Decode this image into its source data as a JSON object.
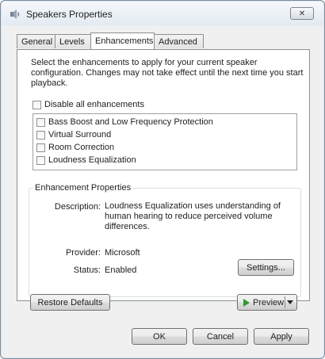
{
  "window": {
    "title": "Speakers Properties",
    "close_glyph": "✕"
  },
  "tabs": [
    {
      "label": "General"
    },
    {
      "label": "Levels"
    },
    {
      "label": "Enhancements",
      "active": true
    },
    {
      "label": "Advanced"
    }
  ],
  "enhancements": {
    "description": "Select the enhancements to apply for your current speaker configuration. Changes may not take effect until the next time you start playback.",
    "disable_all_label": "Disable all enhancements",
    "disable_all_checked": false,
    "items": [
      {
        "label": "Bass Boost and Low Frequency Protection",
        "checked": false
      },
      {
        "label": "Virtual Surround",
        "checked": false
      },
      {
        "label": "Room Correction",
        "checked": false
      },
      {
        "label": "Loudness Equalization",
        "checked": false
      }
    ]
  },
  "properties": {
    "group_label": "Enhancement Properties",
    "description_label": "Description:",
    "description_value": "Loudness Equalization uses understanding of human hearing to reduce perceived volume differences.",
    "provider_label": "Provider:",
    "provider_value": "Microsoft",
    "status_label": "Status:",
    "status_value": "Enabled",
    "settings_button": "Settings..."
  },
  "actions": {
    "restore_defaults": "Restore Defaults",
    "preview": "Preview"
  },
  "footer": {
    "ok": "OK",
    "cancel": "Cancel",
    "apply": "Apply"
  },
  "icons": {
    "window_icon": "speaker-icon",
    "preview_icon": "play-icon",
    "dropdown_icon": "dropdown-arrow-icon"
  },
  "colors": {
    "play_green": "#2f9a2f",
    "title_gradient_top": "#f5f8fb",
    "title_gradient_bottom": "#e3eaf2"
  }
}
